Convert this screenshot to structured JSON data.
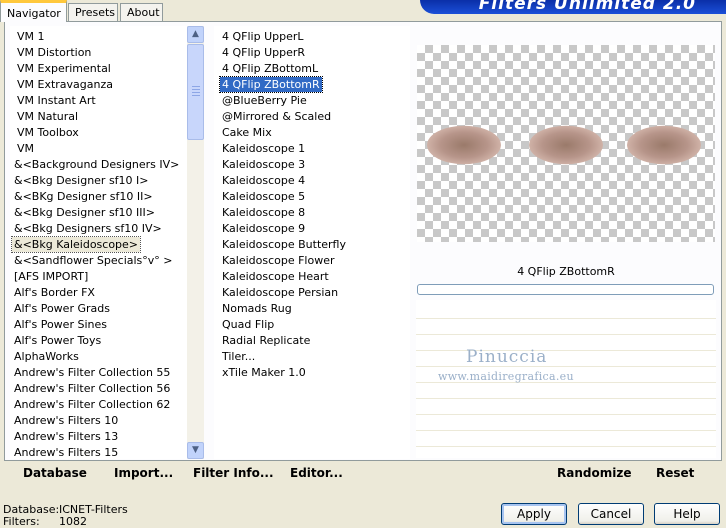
{
  "tabs": [
    {
      "label": "Navigator",
      "active": true
    },
    {
      "label": "Presets",
      "active": false
    },
    {
      "label": "About",
      "active": false
    }
  ],
  "banner_title": "Filters Unlimited 2.0",
  "categories": {
    "items": [
      "VM 1",
      "VM Distortion",
      "VM Experimental",
      "VM Extravaganza",
      "VM Instant Art",
      "VM Natural",
      "VM Toolbox",
      "VM",
      "&<Background Designers IV>",
      "&<Bkg Designer sf10 I>",
      "&<BKg Designer sf10 II>",
      "&<Bkg Designer sf10 III>",
      "&<Bkg Designers sf10 IV>",
      "&<Bkg Kaleidoscope>",
      "&<Sandflower Specials°v° >",
      "[AFS IMPORT]",
      "Alf's Border FX",
      "Alf's Power Grads",
      "Alf's Power Sines",
      "Alf's Power Toys",
      "AlphaWorks",
      "Andrew's Filter Collection 55",
      "Andrew's Filter Collection 56",
      "Andrew's Filter Collection 62",
      "Andrew's Filters 10",
      "Andrew's Filters 13",
      "Andrew's Filters 15"
    ],
    "selected_index": 13
  },
  "filters": {
    "items": [
      "4 QFlip UpperL",
      "4 QFlip UpperR",
      "4 QFlip ZBottomL",
      "4 QFlip ZBottomR",
      "@BlueBerry Pie",
      "@Mirrored & Scaled",
      "Cake Mix",
      "Kaleidoscope 1",
      "Kaleidoscope 3",
      "Kaleidoscope 4",
      "Kaleidoscope 5",
      "Kaleidoscope 8",
      "Kaleidoscope 9",
      "Kaleidoscope Butterfly",
      "Kaleidoscope Flower",
      "Kaleidoscope Heart",
      "Kaleidoscope Persian",
      "Nomads Rug",
      "Quad Flip",
      "Radial Replicate",
      "Tiler...",
      "xTile Maker 1.0"
    ],
    "selected_index": 3
  },
  "preview": {
    "label": "4 QFlip ZBottomR",
    "watermark_name": "Pinuccia",
    "watermark_url": "www.maidiregrafica.eu"
  },
  "toolbar": {
    "database": "Database",
    "import": "Import...",
    "filter_info": "Filter Info...",
    "editor": "Editor...",
    "randomize": "Randomize",
    "reset": "Reset"
  },
  "status": {
    "database_label": "Database:",
    "database_value": "ICNET-Filters",
    "filters_label": "Filters:",
    "filters_value": "1082"
  },
  "buttons": {
    "apply": "Apply",
    "cancel": "Cancel",
    "help": "Help"
  },
  "colors": {
    "selection": "#316ac5",
    "banner": "#0a2fa8",
    "watermark": "#9bb0c9"
  }
}
